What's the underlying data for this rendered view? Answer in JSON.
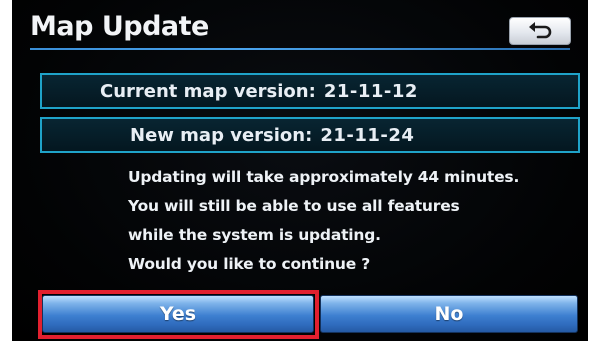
{
  "header": {
    "title": "Map Update",
    "back_icon": "return-arrow-icon"
  },
  "info": {
    "current_label": "Current map version:",
    "current_value": "21-11-12",
    "new_label": "New map version:",
    "new_value": "21-11-24"
  },
  "message": {
    "lines": [
      "Updating will take approximately 44 minutes.",
      "You will still be able to use all features",
      "while the system is updating.",
      "Would you like to continue ?"
    ]
  },
  "buttons": {
    "yes_label": "Yes",
    "no_label": "No"
  },
  "colors": {
    "accent_rule": "#3a8fd8",
    "info_border": "#1fa3c9",
    "button_blue": "#3d7fd0",
    "highlight_red": "#e2202f"
  }
}
